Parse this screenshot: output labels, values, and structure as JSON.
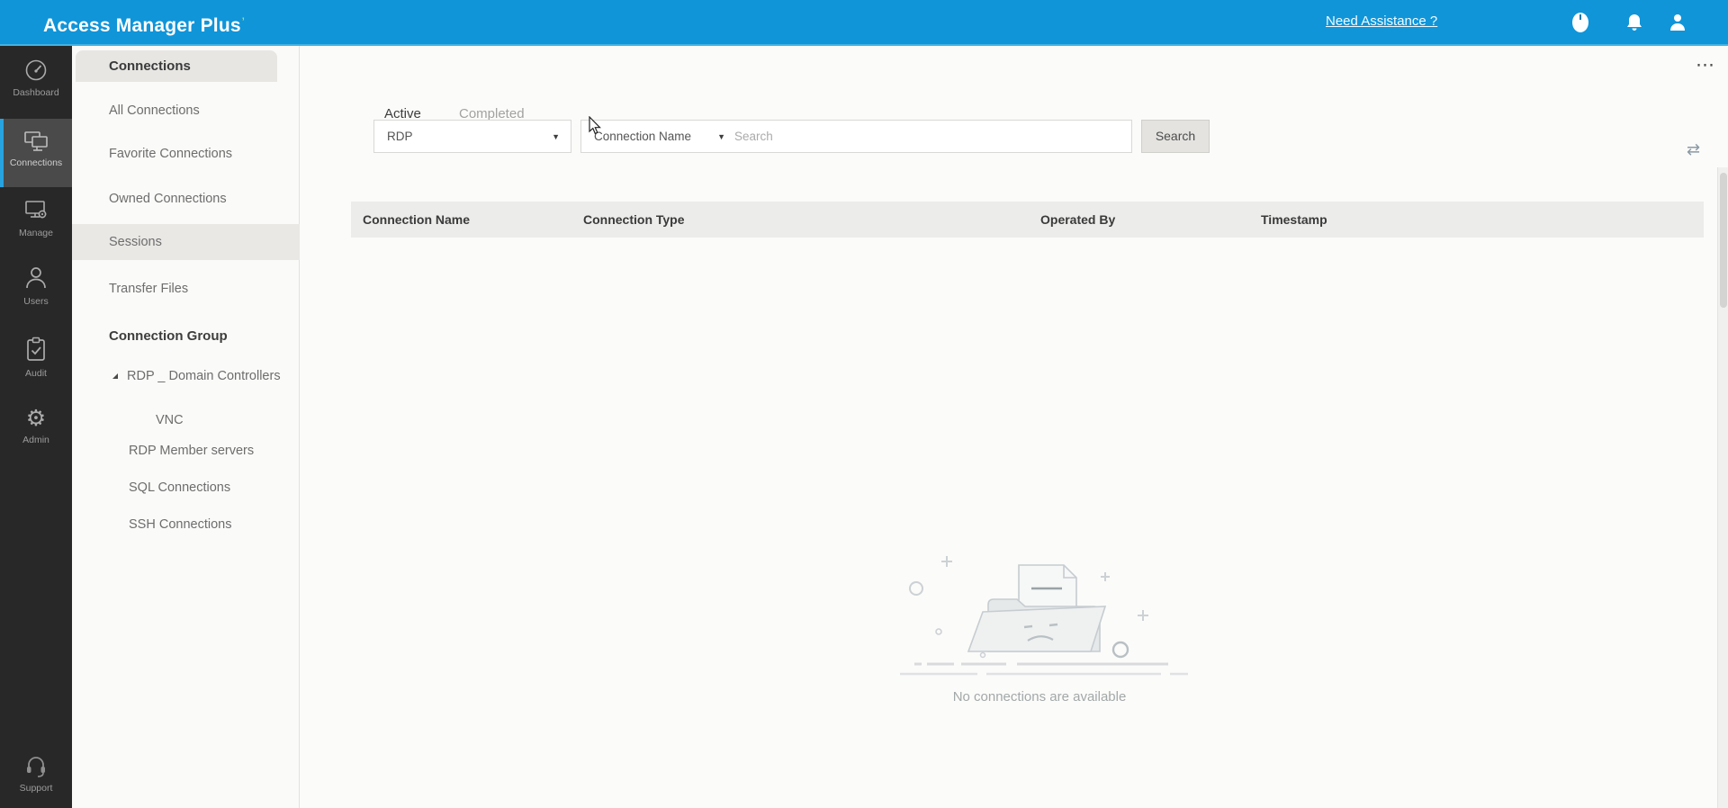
{
  "topbar": {
    "title": "Access Manager Plus",
    "title_mark": "’",
    "need_assistance_label": "Need Assistance ?"
  },
  "primary_nav": {
    "items": [
      {
        "label": "Dashboard",
        "icon": "gauge-icon",
        "active": false
      },
      {
        "label": "Connections",
        "icon": "monitors-icon",
        "active": true
      },
      {
        "label": "Manage",
        "icon": "monitor-gear-icon",
        "active": false
      },
      {
        "label": "Users",
        "icon": "user-outline-icon",
        "active": false
      },
      {
        "label": "Audit",
        "icon": "clipboard-check-icon",
        "active": false
      },
      {
        "label": "Admin",
        "icon": "gear-icon",
        "active": false
      },
      {
        "label": "Support",
        "icon": "headset-icon",
        "active": false
      }
    ]
  },
  "secondary_nav": {
    "tab_title": "Connections",
    "items": [
      {
        "label": "All Connections",
        "active": false
      },
      {
        "label": "Favorite Connections",
        "active": false
      },
      {
        "label": "Owned Connections",
        "active": false
      },
      {
        "label": "Sessions",
        "active": true
      },
      {
        "label": "Transfer Files",
        "active": false
      }
    ],
    "group_header": "Connection Group",
    "tree": [
      {
        "label": "RDP _ Domain Controllers",
        "level": 1,
        "expanded": true
      },
      {
        "label": "VNC",
        "level": 2,
        "expanded": false
      },
      {
        "label": "RDP Member servers",
        "level": 1,
        "expanded": false
      },
      {
        "label": "SQL Connections",
        "level": 1,
        "expanded": false
      },
      {
        "label": "SSH Connections",
        "level": 1,
        "expanded": false
      }
    ]
  },
  "main": {
    "tabs": [
      {
        "label": "Active",
        "active": true
      },
      {
        "label": "Completed",
        "active": false
      }
    ],
    "filters": {
      "protocol_value": "RDP",
      "column_value": "Connection Name",
      "search_placeholder": "Search",
      "search_button_label": "Search"
    },
    "table": {
      "columns": [
        "Connection Name",
        "Connection Type",
        "Operated By",
        "Timestamp"
      ]
    },
    "empty_state": {
      "message": "No connections are available"
    },
    "more_menu_label": "⋯",
    "refresh_glyph": "⇄"
  },
  "colors": {
    "header_blue": "#1095d9",
    "accent_blue": "#2196dc",
    "rail_dark": "#282828",
    "rail_active_bg": "#4a4a4a"
  }
}
